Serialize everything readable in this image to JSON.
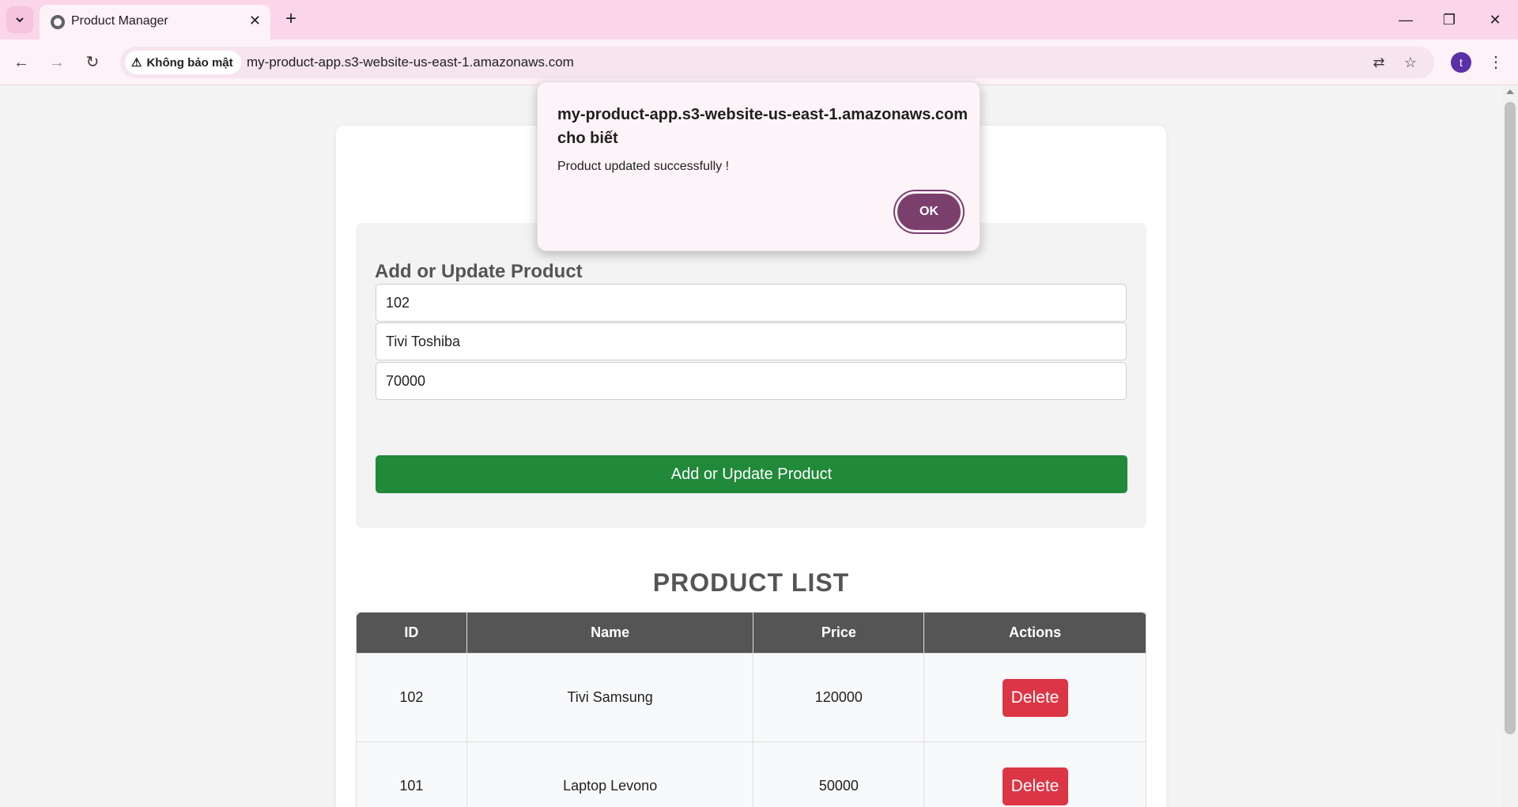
{
  "browser": {
    "tab_title": "Product Manager",
    "tab_close": "✕",
    "new_tab": "+",
    "security_label": "Không bảo mật",
    "url": "my-product-app.s3-website-us-east-1.amazonaws.com",
    "profile_initial": "t"
  },
  "dialog": {
    "origin": "my-product-app.s3-website-us-east-1.amazonaws.com cho biết",
    "message": "Product updated successfully !",
    "ok_label": "OK"
  },
  "form": {
    "title": "Add or Update Product",
    "id_value": "102",
    "name_value": "Tivi Toshiba",
    "price_value": "70000",
    "submit_label": "Add or Update Product"
  },
  "product_list": {
    "title": "PRODUCT LIST",
    "columns": [
      "ID",
      "Name",
      "Price",
      "Actions"
    ],
    "rows": [
      {
        "id": "102",
        "name": "Tivi Samsung",
        "price": "120000",
        "action": "Delete"
      },
      {
        "id": "101",
        "name": "Laptop Levono",
        "price": "50000",
        "action": "Delete"
      }
    ]
  },
  "colors": {
    "submit": "#208a3a",
    "delete": "#dc3545",
    "ok": "#7b3f6e",
    "table_header": "#555555"
  }
}
